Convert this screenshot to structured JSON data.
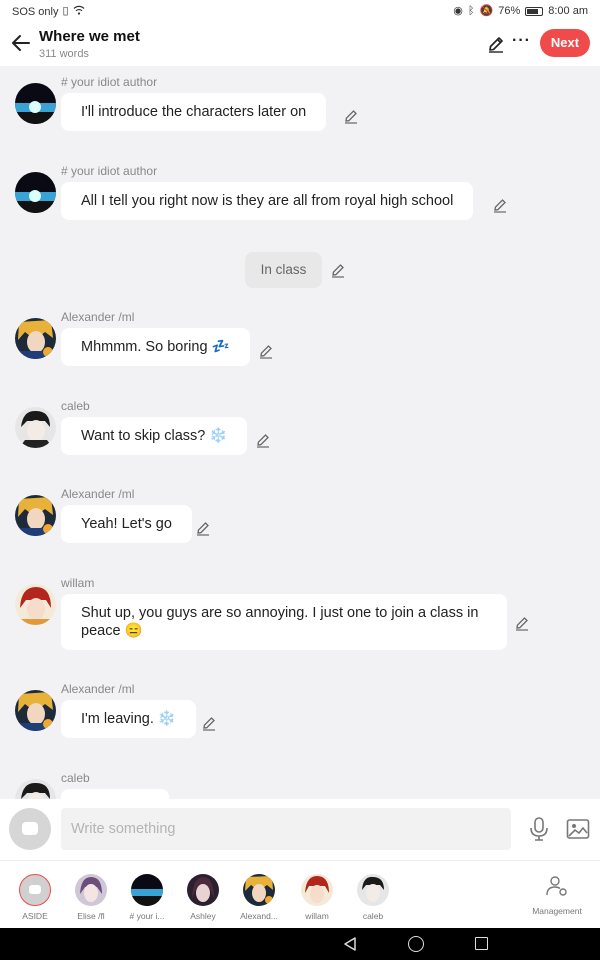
{
  "status_bar": {
    "carrier": "SOS only",
    "battery": "76%",
    "time": "8:00 am"
  },
  "header": {
    "title": "Where we met",
    "word_count": "311 words",
    "next_label": "Next"
  },
  "messages": [
    {
      "type": "dialogue",
      "sender": "# your idiot author",
      "text": "I'll introduce  the characters later on"
    },
    {
      "type": "dialogue",
      "sender": "# your idiot author",
      "text": "All I tell you right now is they are all from royal high school"
    },
    {
      "type": "narration",
      "text": "In class"
    },
    {
      "type": "dialogue",
      "sender": "Alexander /ml",
      "text": "Mhmmm. So boring 💤"
    },
    {
      "type": "dialogue",
      "sender": "caleb",
      "text": "Want to skip class? ❄️"
    },
    {
      "type": "dialogue",
      "sender": "Alexander /ml",
      "text": "Yeah! Let's go"
    },
    {
      "type": "dialogue",
      "sender": "willam",
      "text": "Shut up, you guys are so annoying. I just one to join a class in peace 😑"
    },
    {
      "type": "dialogue",
      "sender": "Alexander /ml",
      "text": "I'm leaving. ❄️"
    },
    {
      "type": "dialogue",
      "sender": "caleb",
      "text": ""
    }
  ],
  "composer": {
    "placeholder": "Write something"
  },
  "characters": [
    {
      "label": "ASIDE"
    },
    {
      "label": "Elise /fl"
    },
    {
      "label": "# your i..."
    },
    {
      "label": "Ashley"
    },
    {
      "label": "Alexand..."
    },
    {
      "label": "willam"
    },
    {
      "label": "caleb"
    }
  ],
  "management_label": "Management",
  "colors": {
    "accent": "#f04a4a",
    "background": "#f2f2f4",
    "bubble": "#ffffff",
    "narration_bubble": "#e8e8e8"
  }
}
